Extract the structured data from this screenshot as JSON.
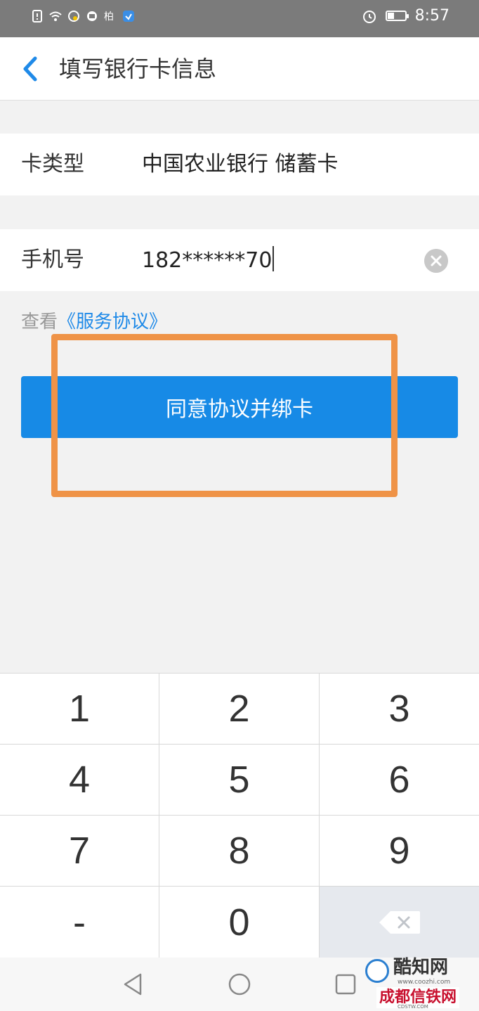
{
  "status_bar": {
    "time": "8:57",
    "icons": [
      "sim-alert-icon",
      "wifi-icon",
      "app-notification-icon",
      "app-notification-icon",
      "app-notification-icon",
      "app-notification-icon",
      "alarm-icon",
      "battery-icon"
    ]
  },
  "header": {
    "title": "填写银行卡信息",
    "back_icon": "chevron-left-icon"
  },
  "form": {
    "card_type": {
      "label": "卡类型",
      "value": "中国农业银行 储蓄卡"
    },
    "phone": {
      "label": "手机号",
      "value": "182******70",
      "clear_icon": "clear-circle-icon"
    }
  },
  "agreement": {
    "prefix": "查看",
    "link": "《服务协议》"
  },
  "primary_button": {
    "label": "同意协议并绑卡"
  },
  "keypad": {
    "keys": [
      "1",
      "2",
      "3",
      "4",
      "5",
      "6",
      "7",
      "8",
      "9",
      "-",
      "0"
    ],
    "delete_icon": "backspace-icon"
  },
  "system_nav": {
    "icons": [
      "back-triangle-icon",
      "home-circle-icon",
      "recents-square-icon"
    ]
  },
  "watermark": {
    "title": "酷知网",
    "url": "www.coozhi.com",
    "subtitle": "成都信铁网",
    "footnote": "CDSTW.COM"
  },
  "colors": {
    "accent": "#178ae6",
    "annotation": "#ef9347",
    "link": "#1f8ae8"
  }
}
